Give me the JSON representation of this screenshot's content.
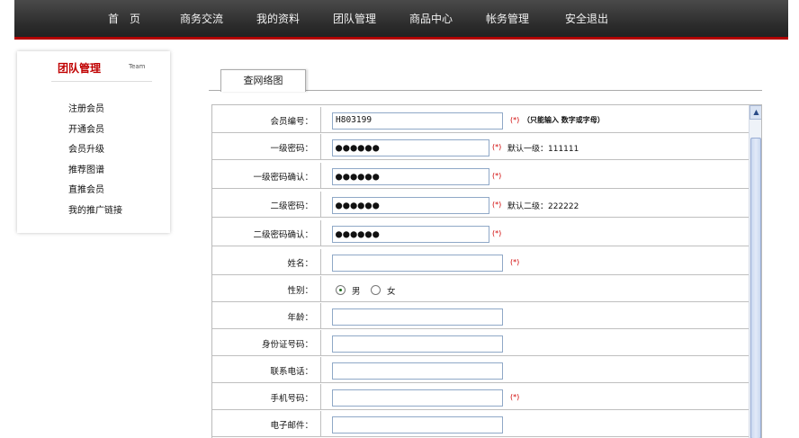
{
  "nav": {
    "items": [
      "首　页",
      "商务交流",
      "我的资料",
      "团队管理",
      "商品中心",
      "帐务管理",
      "安全退出"
    ]
  },
  "sidebar": {
    "title": "团队管理",
    "title_en": "Team",
    "items": [
      "注册会员",
      "开通会员",
      "会员升级",
      "推荐图谱",
      "直推会员",
      "我的推广链接"
    ]
  },
  "tab": {
    "label": "查网络图"
  },
  "form": {
    "member_id_label": "会员编号：",
    "member_id_value": "H803199",
    "member_id_note": "（只能输入 数字或字母）",
    "pwd1_label": "一级密码：",
    "pwd1_value": "●●●●●●",
    "pwd1_hint": "默认一级：111111",
    "pwd1_confirm_label": "一级密码确认：",
    "pwd1_confirm_value": "●●●●●●",
    "pwd2_label": "二级密码：",
    "pwd2_value": "●●●●●●",
    "pwd2_hint": "默认二级：222222",
    "pwd2_confirm_label": "二级密码确认：",
    "pwd2_confirm_value": "●●●●●●",
    "name_label": "姓名：",
    "gender_label": "性别：",
    "gender_male": "男",
    "gender_female": "女",
    "age_label": "年龄：",
    "idcard_label": "身份证号码：",
    "phone_label": "联系电话：",
    "mobile_label": "手机号码：",
    "email_label": "电子邮件：",
    "required_mark": "(*)"
  }
}
